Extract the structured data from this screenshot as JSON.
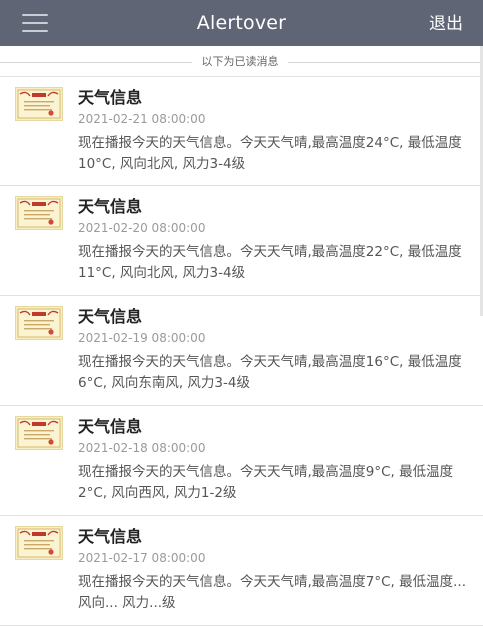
{
  "header": {
    "title": "Alertover",
    "logout_label": "退出"
  },
  "divider": {
    "label": "以下为已读消息"
  },
  "messages": [
    {
      "title": "天气信息",
      "time": "2021-02-21 08:00:00",
      "body": "现在播报今天的天气信息。今天天气晴,最高温度24°C, 最低温度10°C, 风向北风, 风力3-4级"
    },
    {
      "title": "天气信息",
      "time": "2021-02-20 08:00:00",
      "body": "现在播报今天的天气信息。今天天气晴,最高温度22°C, 最低温度11°C, 风向北风, 风力3-4级"
    },
    {
      "title": "天气信息",
      "time": "2021-02-19 08:00:00",
      "body": "现在播报今天的天气信息。今天天气晴,最高温度16°C, 最低温度6°C, 风向东南风, 风力3-4级"
    },
    {
      "title": "天气信息",
      "time": "2021-02-18 08:00:00",
      "body": "现在播报今天的天气信息。今天天气晴,最高温度9°C, 最低温度2°C, 风向西风, 风力1-2级"
    },
    {
      "title": "天气信息",
      "time": "2021-02-17 08:00:00",
      "body": "现在播报今天的天气信息。今天天气晴,最高温度7°C, 最低温度... 风向... 风力...级"
    }
  ],
  "icons": {
    "menu": "hamburger-menu-icon",
    "message_thumbnail": "certificate-thumbnail-icon"
  },
  "colors": {
    "header_bg": "#5f6575",
    "header_text": "#ffffff",
    "title_text": "#222222",
    "time_text": "#9a9a9a",
    "body_text": "#555555"
  }
}
